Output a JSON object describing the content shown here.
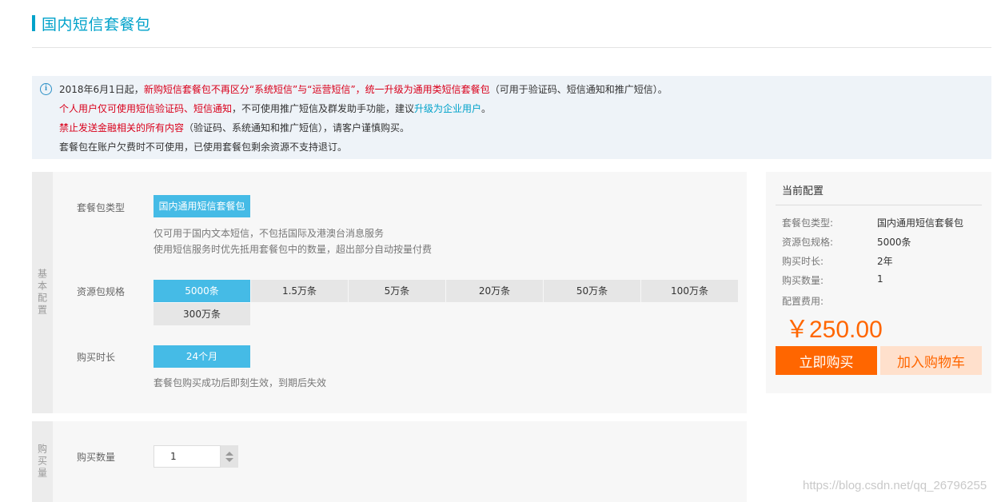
{
  "page": {
    "title": "国内短信套餐包"
  },
  "notice": {
    "icon": "info-icon",
    "line1_date": "2018年6月1日起，",
    "line1_red": "新购短信套餐包不再区分“系统短信”与“运营短信”，统一升级为通用类短信套餐包",
    "line1_tail": "（可用于验证码、短信通知和推广短信）。",
    "line2_red": "个人用户仅可使用短信验证码、短信通知",
    "line2_mid": "，不可使用推广短信及群发助手功能，建议",
    "line2_link": "升级为企业用户",
    "line2_end": "。",
    "line3_red": "禁止发送金融相关的所有内容",
    "line3_tail": "（验证码、系统通知和推广短信），请客户谨慎购买。",
    "line4": "套餐包在账户欠费时不可使用，已使用套餐包剩余资源不支持退订。"
  },
  "basic": {
    "side_label": "基本配置",
    "package_type": {
      "label": "套餐包类型",
      "option": "国内通用短信套餐包",
      "hint1": "仅可用于国内文本短信，不包括国际及港澳台消息服务",
      "hint2": "使用短信服务时优先抵用套餐包中的数量，超出部分自动按量付费"
    },
    "spec": {
      "label": "资源包规格",
      "options": [
        "5000条",
        "1.5万条",
        "5万条",
        "20万条",
        "50万条",
        "100万条",
        "300万条"
      ],
      "selected": "5000条"
    },
    "duration": {
      "label": "购买时长",
      "option": "24个月",
      "hint": "套餐包购买成功后即刻生效，到期后失效"
    }
  },
  "quantity": {
    "side_label": "购买量",
    "label": "购买数量",
    "value": "1"
  },
  "config": {
    "title": "当前配置",
    "rows": [
      {
        "key": "套餐包类型:",
        "value": "国内通用短信套餐包"
      },
      {
        "key": "资源包规格:",
        "value": "5000条"
      },
      {
        "key": "购买时长:",
        "value": "2年"
      },
      {
        "key": "购买数量:",
        "value": "1"
      }
    ],
    "fee_label": "配置费用:",
    "price": "￥250.00",
    "buy_label": "立即购买",
    "cart_label": "加入购物车"
  },
  "watermark": "https://blog.csdn.net/qq_26796255",
  "colors": {
    "accent": "#00a2ca",
    "selected": "#45bbe6",
    "warning": "#d9001b",
    "price": "#ff6600"
  }
}
